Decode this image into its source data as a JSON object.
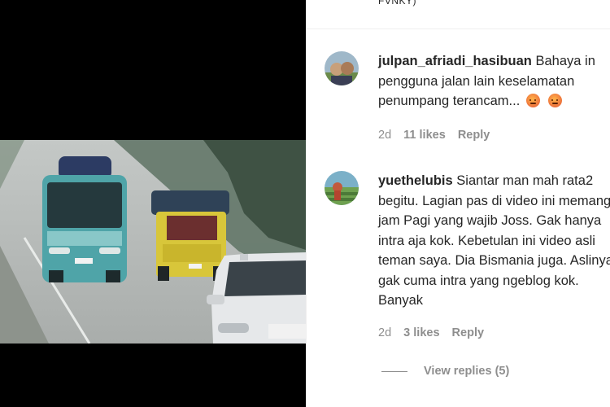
{
  "post": {
    "top_text": "FVNKY)"
  },
  "comments": [
    {
      "username": "julpan_afriadi_hasibuan",
      "text": "Bahaya in pengguna jalan lain keselamatan penumpang terancam...",
      "emojis": [
        "angry-face-icon",
        "angry-face-icon"
      ],
      "time": "2d",
      "likes": "11 likes",
      "reply": "Reply"
    },
    {
      "username": "yuethelubis",
      "text": "Siantar man mah rata2 begitu. Lagian pas di video ini memang jam Pagi yang wajib Joss. Gak hanya intra aja kok. Kebetulan ini video asli teman saya. Dia Bismania juga. Aslinya gak cuma intra yang ngeblog kok. Banyak",
      "time": "2d",
      "likes": "3 likes",
      "reply": "Reply",
      "view_replies": "View replies (5)"
    }
  ],
  "colors": {
    "text": "#262626",
    "secondary": "#8e8e8e",
    "divider": "#efefef"
  }
}
